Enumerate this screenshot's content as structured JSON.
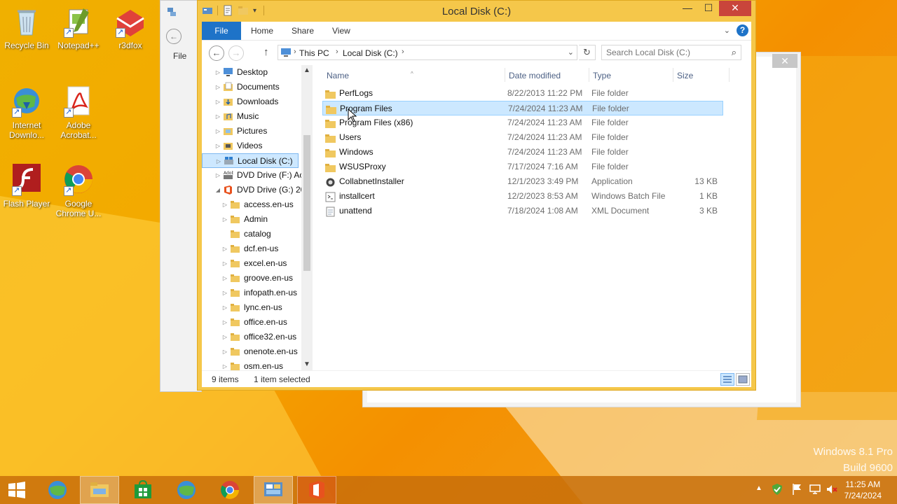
{
  "desktop": {
    "icons": [
      {
        "label": "Recycle Bin"
      },
      {
        "label": "Notepad++"
      },
      {
        "label": "r3dfox"
      },
      {
        "label": "Internet Downlo..."
      },
      {
        "label": "Adobe Acrobat..."
      },
      {
        "label": "Flash Player"
      },
      {
        "label": "Google Chrome U..."
      }
    ],
    "watermark": {
      "line1": "Windows 8.1 Pro",
      "line2": "Build 9600"
    }
  },
  "background_window": {
    "menu_label": "File",
    "close_glyph": "✕"
  },
  "explorer": {
    "title": "Local Disk (C:)",
    "controls": {
      "minimize": "—",
      "maximize": "☐",
      "close": "✕"
    },
    "ribbon": {
      "tabs": [
        "File",
        "Home",
        "Share",
        "View"
      ],
      "chevron": "⌄",
      "help": "?"
    },
    "address": {
      "back": "←",
      "forward": "→",
      "up": "↑",
      "refresh": "↻",
      "crumbs": [
        "This PC",
        "Local Disk (C:)"
      ],
      "separator": "›",
      "dropdown": "⌄"
    },
    "search": {
      "placeholder": "Search Local Disk (C:)",
      "icon": "⌕"
    },
    "nav_tree": [
      {
        "label": "Desktop",
        "icon": "desktop",
        "level": 1,
        "expander": "▷"
      },
      {
        "label": "Documents",
        "icon": "documents",
        "level": 1,
        "expander": "▷"
      },
      {
        "label": "Downloads",
        "icon": "downloads",
        "level": 1,
        "expander": "▷"
      },
      {
        "label": "Music",
        "icon": "music",
        "level": 1,
        "expander": "▷"
      },
      {
        "label": "Pictures",
        "icon": "pictures",
        "level": 1,
        "expander": "▷"
      },
      {
        "label": "Videos",
        "icon": "videos",
        "level": 1,
        "expander": "▷"
      },
      {
        "label": "Local Disk (C:)",
        "icon": "drive",
        "level": 1,
        "expander": "▷",
        "selected": true
      },
      {
        "label": "DVD Drive (F:) Ac",
        "icon": "dvd-adobe",
        "level": 1,
        "expander": "▷"
      },
      {
        "label": "DVD Drive (G:) 20",
        "icon": "dvd-office",
        "level": 1,
        "expander": "◢"
      },
      {
        "label": "access.en-us",
        "icon": "folder",
        "level": 2,
        "expander": "▷"
      },
      {
        "label": "Admin",
        "icon": "folder",
        "level": 2,
        "expander": "▷"
      },
      {
        "label": "catalog",
        "icon": "folder",
        "level": 2,
        "expander": ""
      },
      {
        "label": "dcf.en-us",
        "icon": "folder",
        "level": 2,
        "expander": "▷"
      },
      {
        "label": "excel.en-us",
        "icon": "folder",
        "level": 2,
        "expander": "▷"
      },
      {
        "label": "groove.en-us",
        "icon": "folder",
        "level": 2,
        "expander": "▷"
      },
      {
        "label": "infopath.en-us",
        "icon": "folder",
        "level": 2,
        "expander": "▷"
      },
      {
        "label": "lync.en-us",
        "icon": "folder",
        "level": 2,
        "expander": "▷"
      },
      {
        "label": "office.en-us",
        "icon": "folder",
        "level": 2,
        "expander": "▷"
      },
      {
        "label": "office32.en-us",
        "icon": "folder",
        "level": 2,
        "expander": "▷"
      },
      {
        "label": "onenote.en-us",
        "icon": "folder",
        "level": 2,
        "expander": "▷"
      },
      {
        "label": "osm.en-us",
        "icon": "folder",
        "level": 2,
        "expander": "▷"
      }
    ],
    "scroll_arrows": {
      "up": "▲",
      "down": "▼"
    },
    "columns": {
      "name": "Name",
      "date": "Date modified",
      "type": "Type",
      "size": "Size",
      "sort_glyph": "^"
    },
    "files": [
      {
        "name": "PerfLogs",
        "date": "8/22/2013 11:22 PM",
        "type": "File folder",
        "size": "",
        "icon": "folder"
      },
      {
        "name": "Program Files",
        "date": "7/24/2024 11:23 AM",
        "type": "File folder",
        "size": "",
        "icon": "folder",
        "selected": true
      },
      {
        "name": "Program Files (x86)",
        "date": "7/24/2024 11:23 AM",
        "type": "File folder",
        "size": "",
        "icon": "folder"
      },
      {
        "name": "Users",
        "date": "7/24/2024 11:23 AM",
        "type": "File folder",
        "size": "",
        "icon": "folder"
      },
      {
        "name": "Windows",
        "date": "7/24/2024 11:23 AM",
        "type": "File folder",
        "size": "",
        "icon": "folder"
      },
      {
        "name": "WSUSProxy",
        "date": "7/17/2024 7:16 AM",
        "type": "File folder",
        "size": "",
        "icon": "folder"
      },
      {
        "name": "CollabnetInstaller",
        "date": "12/1/2023 3:49 PM",
        "type": "Application",
        "size": "13 KB",
        "icon": "app"
      },
      {
        "name": "installcert",
        "date": "12/2/2023 8:53 AM",
        "type": "Windows Batch File",
        "size": "1 KB",
        "icon": "batch"
      },
      {
        "name": "unattend",
        "date": "7/18/2024 1:08 AM",
        "type": "XML Document",
        "size": "3 KB",
        "icon": "xml"
      }
    ],
    "status": {
      "count": "9 items",
      "selection": "1 item selected"
    }
  },
  "taskbar": {
    "apps": [
      "start",
      "ie-downloader",
      "file-explorer",
      "store",
      "ie",
      "chrome",
      "control-panel",
      "office"
    ],
    "active_app": "file-explorer",
    "tray": {
      "chevron": "▲"
    },
    "clock": {
      "time": "11:25 AM",
      "date": "7/24/2024"
    }
  },
  "colors": {
    "accent": "#1e73c8",
    "window_frame": "#f5c74a",
    "selection": "#cce8ff"
  }
}
